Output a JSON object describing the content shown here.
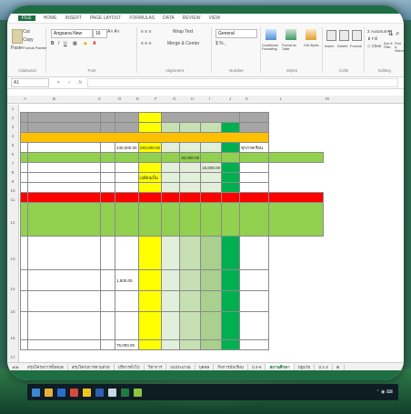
{
  "menu": {
    "file": "FILE",
    "items": [
      "HOME",
      "INSERT",
      "PAGE LAYOUT",
      "FORMULAS",
      "DATA",
      "REVIEW",
      "VIEW"
    ]
  },
  "ribbon": {
    "cut": "Cut",
    "copy": "Copy",
    "format_painter": "Format Painter",
    "paste": "Paste",
    "font_name": "Angsana New",
    "font_size": "16",
    "wrap_text": "Wrap Text",
    "merge_center": "Merge & Center",
    "number_format": "General",
    "conditional_formatting": "Conditional Formatting",
    "format_as_table": "Format as Table",
    "cell_styles": "Cell Styles",
    "insert": "Insert",
    "delete": "Delete",
    "format": "Format",
    "autosum": "AutoSum",
    "fill": "Fill",
    "clear": "Clear",
    "sort_filter": "Sort & Filter",
    "find_select": "Find & Select",
    "group_labels": [
      "Clipboard",
      "Font",
      "Alignment",
      "Number",
      "Styles",
      "Cells",
      "Editing"
    ]
  },
  "formula_bar": {
    "name_box": "A1",
    "fx": "fx"
  },
  "columns": [
    "A",
    "B",
    "C",
    "D",
    "E",
    "F",
    "G",
    "H",
    "I",
    "J",
    "K",
    "L",
    "M"
  ],
  "rows": [
    "1",
    "2",
    "3",
    "4",
    "5",
    "6",
    "7",
    "8",
    "9",
    "10",
    "11",
    "12",
    "13",
    "14",
    "15",
    "16",
    "17"
  ],
  "sheet": {
    "values": [
      "230,000.00",
      "230,000.00",
      "ทุกภาคเรียน",
      "30,000.00",
      "15,000.00",
      "เปลี่ยนเป็น",
      "1,500.00",
      "75,000.00"
    ]
  },
  "tabs": {
    "labels": [
      "สรุปโครงการทั้งหมด",
      "สรุปโครงการตามฝ่าย",
      "บริหารทั่วไป",
      "วิชาการ",
      "งบประมาณ",
      "บุคคล",
      "กิจการนักเรียน",
      "ป.4-6",
      "สถานศึกษา",
      "ปฐมวัย",
      "ป.1-3"
    ],
    "active_index": 8
  },
  "colors": {
    "excel_green": "#1f6e43",
    "header_gray": "#a6a6a6",
    "yellow": "#ffff00",
    "light_green": "#92d050",
    "red": "#ff0000",
    "dark_green": "#00b050"
  }
}
